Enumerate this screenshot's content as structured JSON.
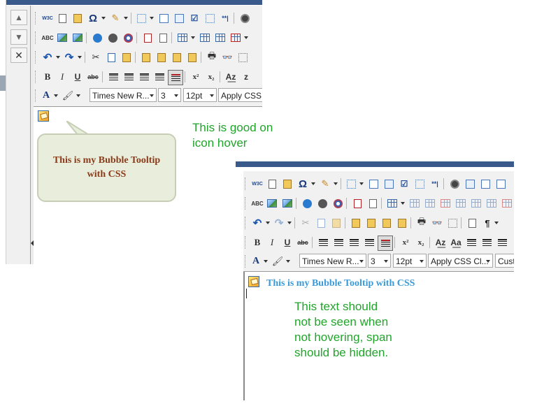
{
  "toolbar": {
    "font_name": "Times New R...",
    "font_size": "3",
    "point_size": "12pt",
    "css_class_short": "Apply CSS C",
    "css_class": "Apply CSS Cl...",
    "custom": "Cust"
  },
  "bubble_tooltip": {
    "line1": "This is my Bubble Tooltip",
    "line2": "with CSS"
  },
  "inline_tooltip": "This is my Bubble Tooltip with CSS",
  "annotations": {
    "good": [
      "This is good on",
      "icon hover"
    ],
    "bad": [
      "This text should",
      "not be seen when",
      "not hovering, span",
      "should be hidden."
    ]
  },
  "colors": {
    "annotation": "#22a42c",
    "tooltip_text": "#8b3a1a",
    "inline_text": "#3a9ad8",
    "bubble_bg": "#e8eedb",
    "header_stripe": "#3a5a8c"
  },
  "icons": [
    "w3c-validate-icon",
    "spellcheck-icon",
    "omega-icon",
    "bold-icon",
    "italic-icon",
    "underline-icon",
    "strikethrough-icon",
    "superscript-icon",
    "subscript-icon",
    "undo-icon",
    "redo-icon",
    "cut-icon",
    "copy-icon",
    "paste-icon",
    "print-icon",
    "find-icon",
    "table-icon",
    "image-icon",
    "font-color-icon",
    "highlight-icon"
  ]
}
